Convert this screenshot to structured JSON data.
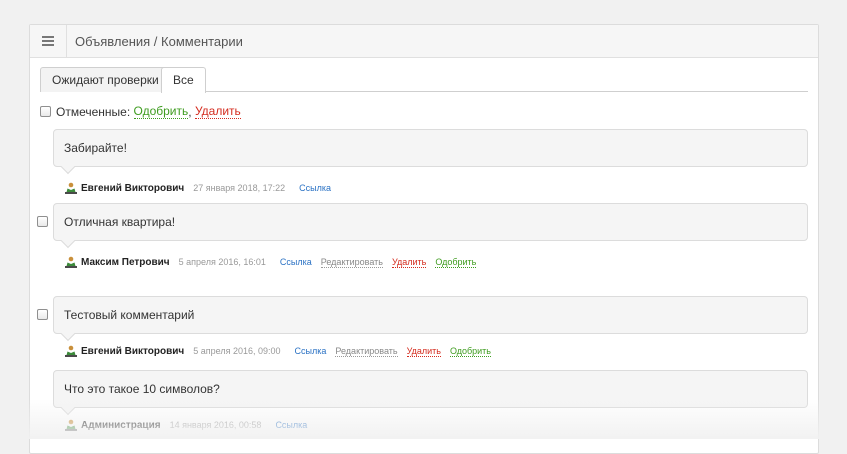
{
  "header": {
    "title": "Объявления / Комментарии",
    "menu_icon": "menu-icon"
  },
  "tabs": [
    {
      "label": "Ожидают проверки",
      "active": false
    },
    {
      "label": "Все",
      "active": true
    }
  ],
  "marked": {
    "label": "Отмеченные:",
    "approve": "Одобрить",
    "separator": ",",
    "delete": "Удалить"
  },
  "colors": {
    "approve": "#3e9c1f",
    "delete": "#d42b1e",
    "link": "#2b72c4",
    "muted": "#999999"
  },
  "comments": [
    {
      "text": "Забирайте!",
      "author": "Евгений Викторович",
      "date": "27 января 2018, 17:22",
      "link": "Ссылка",
      "has_checkbox": false
    },
    {
      "text": "Отличная квартира!",
      "author": "Максим Петрович",
      "date": "5 апреля 2016, 16:01",
      "link": "Ссылка",
      "edit": "Редактировать",
      "delete": "Удалить",
      "approve": "Одобрить",
      "has_checkbox": true
    },
    {
      "text": "Тестовый комментарий",
      "author": "Евгений Викторович",
      "date": "5 апреля 2016, 09:00",
      "link": "Ссылка",
      "edit": "Редактировать",
      "delete": "Удалить",
      "approve": "Одобрить",
      "has_checkbox": true
    },
    {
      "text": "Что это такое 10 символов?",
      "author": "Администрация",
      "date": "14 января 2016, 00:58",
      "link": "Ссылка",
      "has_checkbox": false
    }
  ]
}
